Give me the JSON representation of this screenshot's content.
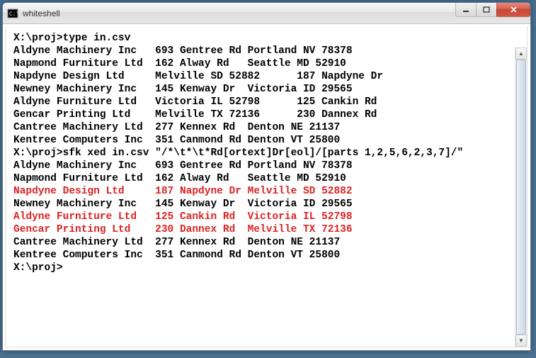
{
  "window": {
    "title": "whiteshell"
  },
  "prompt1": "X:\\proj>",
  "cmd1": "type in.csv",
  "rows1": [
    {
      "c1": "Aldyne Machinery Inc   ",
      "c2": "693 Gentree Rd ",
      "c3": "Portland NV 78378",
      "red": false
    },
    {
      "c1": "Napmond Furniture Ltd  ",
      "c2": "162 Alway Rd   ",
      "c3": "Seattle MD 52910",
      "red": false
    },
    {
      "c1": "Napdyne Design Ltd     ",
      "c2": "Melville SD 52882      ",
      "c3": "187 Napdyne Dr",
      "red": false
    },
    {
      "c1": "Newney Machinery Inc   ",
      "c2": "145 Kenway Dr  ",
      "c3": "Victoria ID 29565",
      "red": false
    },
    {
      "c1": "Aldyne Furniture Ltd   ",
      "c2": "Victoria IL 52798      ",
      "c3": "125 Cankin Rd",
      "red": false
    },
    {
      "c1": "Gencar Printing Ltd    ",
      "c2": "Melville TX 72136      ",
      "c3": "230 Dannex Rd",
      "red": false
    },
    {
      "c1": "Cantree Machinery Ltd  ",
      "c2": "277 Kennex Rd  ",
      "c3": "Denton NE 21137",
      "red": false
    },
    {
      "c1": "Kentree Computers Inc  ",
      "c2": "351 Canmond Rd ",
      "c3": "Denton VT 25800",
      "red": false
    }
  ],
  "prompt2": "X:\\proj>",
  "cmd2": "sfk xed in.csv \"/*\\t*\\t*Rd[ortext]Dr[eol]/[parts 1,2,5,6,2,3,7]/\"",
  "rows2": [
    {
      "c1": "Aldyne Machinery Inc   ",
      "c2": "693 Gentree Rd ",
      "c3": "Portland NV 78378",
      "red": false
    },
    {
      "c1": "Napmond Furniture Ltd  ",
      "c2": "162 Alway Rd   ",
      "c3": "Seattle MD 52910",
      "red": false
    },
    {
      "c1": "Napdyne Design Ltd     ",
      "c2": "187 Napdyne Dr ",
      "c3": "Melville SD 52882",
      "red": true
    },
    {
      "c1": "Newney Machinery Inc   ",
      "c2": "145 Kenway Dr  ",
      "c3": "Victoria ID 29565",
      "red": false
    },
    {
      "c1": "Aldyne Furniture Ltd   ",
      "c2": "125 Cankin Rd  ",
      "c3": "Victoria IL 52798",
      "red": true
    },
    {
      "c1": "Gencar Printing Ltd    ",
      "c2": "230 Dannex Rd  ",
      "c3": "Melville TX 72136",
      "red": true
    },
    {
      "c1": "Cantree Machinery Ltd  ",
      "c2": "277 Kennex Rd  ",
      "c3": "Denton NE 21137",
      "red": false
    },
    {
      "c1": "Kentree Computers Inc  ",
      "c2": "351 Canmond Rd ",
      "c3": "Denton VT 25800",
      "red": false
    }
  ],
  "prompt3": "X:\\proj>"
}
